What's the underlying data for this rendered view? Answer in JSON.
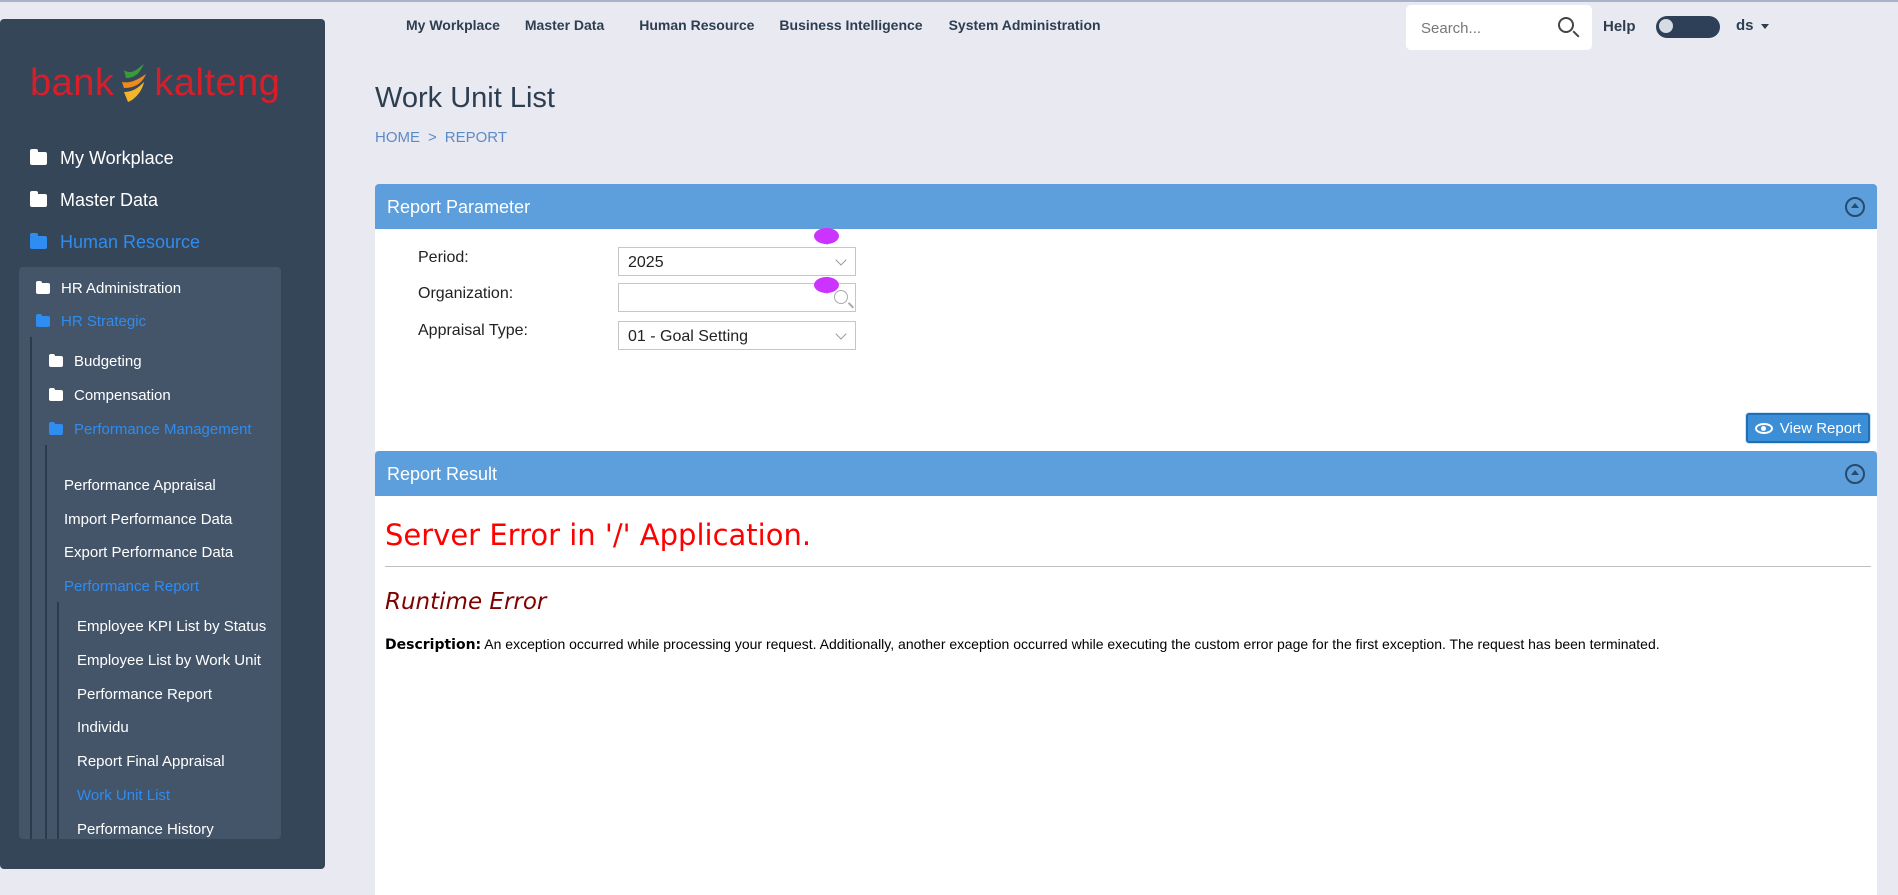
{
  "brand": {
    "logo_text_left": "bank",
    "logo_text_right": "kalteng"
  },
  "sidebar": {
    "level1": [
      {
        "label": "My Workplace",
        "active": false
      },
      {
        "label": "Master Data",
        "active": false
      },
      {
        "label": "Human Resource",
        "active": true
      }
    ],
    "hr": [
      {
        "label": "HR Administration",
        "active": false
      },
      {
        "label": "HR Strategic",
        "active": true
      }
    ],
    "strategic": [
      {
        "label": "Budgeting",
        "active": false
      },
      {
        "label": "Compensation",
        "active": false
      },
      {
        "label": "Performance Management",
        "active": true
      }
    ],
    "performance": [
      {
        "label": "Performance Appraisal",
        "active": false
      },
      {
        "label": "Import Performance Data",
        "active": false
      },
      {
        "label": "Export Performance Data",
        "active": false
      },
      {
        "label": "Performance Report",
        "active": true
      }
    ],
    "reports": [
      {
        "label": "Employee KPI List by Status",
        "active": false
      },
      {
        "label": "Employee List by Work Unit",
        "active": false
      },
      {
        "label": "Performance Report",
        "active": false
      },
      {
        "label": "Individu",
        "active": false
      },
      {
        "label": "Report Final Appraisal",
        "active": false
      },
      {
        "label": "Work Unit List",
        "active": true
      },
      {
        "label": "Performance History",
        "active": false
      }
    ]
  },
  "topnav": {
    "items": [
      "My Workplace",
      "Master Data",
      "Human Resource",
      "Business Intelligence",
      "System Administration"
    ],
    "search_placeholder": "Search...",
    "help": "Help",
    "user": "ds"
  },
  "page": {
    "title": "Work Unit List",
    "breadcrumb": [
      "HOME",
      ">",
      "REPORT"
    ]
  },
  "report_parameter": {
    "header": "Report Parameter",
    "period_label": "Period:",
    "period_value": "2025",
    "organization_label": "Organization:",
    "organization_value": "",
    "appraisal_type_label": "Appraisal Type:",
    "appraisal_type_value": "01 - Goal Setting",
    "view_button": "View Report"
  },
  "report_result": {
    "header": "Report Result",
    "error_title": "Server Error in '/' Application.",
    "error_subtitle": "Runtime Error",
    "description_label": "Description:",
    "description_text": "An exception occurred while processing your request. Additionally, another exception occurred while executing the custom error page for the first exception. The request has been terminated."
  },
  "colors": {
    "sidebar_bg": "#364659",
    "sidebar_sub_bg": "#44556a",
    "active_link": "#2f8cf0",
    "panel_header": "#5c9fdc",
    "error_red": "#ff0000",
    "error_maroon": "#800000",
    "logo_red": "#d81e28"
  }
}
